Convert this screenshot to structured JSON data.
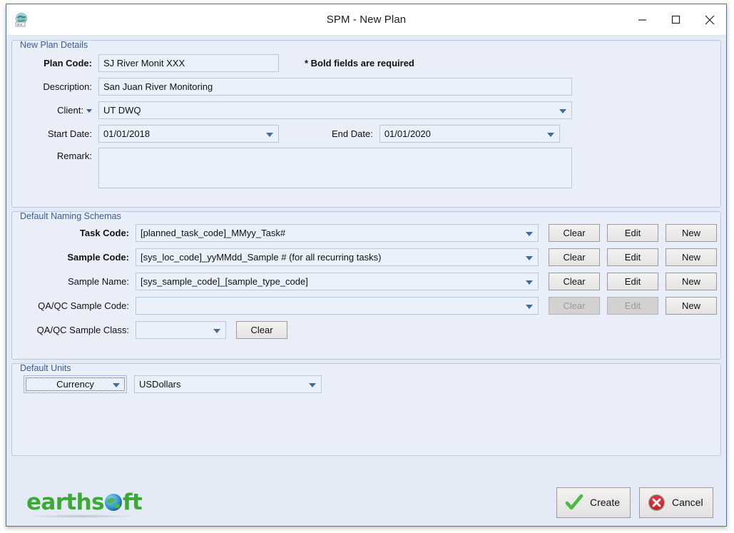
{
  "window": {
    "title": "SPM - New Plan",
    "app_icon": "globe-app-icon",
    "minimize": "–",
    "maximize": "□",
    "close": "✕"
  },
  "plan_details": {
    "legend": "New Plan Details",
    "required_note": "* Bold fields are required",
    "fields": {
      "plan_code_label": "Plan Code:",
      "plan_code_value": "SJ River Monit XXX",
      "description_label": "Description:",
      "description_value": "San Juan River Monitoring",
      "client_label": "Client:",
      "client_value": "UT DWQ",
      "start_date_label": "Start Date:",
      "start_date_value": "01/01/2018",
      "end_date_label": "End Date:",
      "end_date_value": "01/01/2020",
      "remark_label": "Remark:",
      "remark_value": ""
    }
  },
  "naming_schemas": {
    "legend": "Default Naming Schemas",
    "buttons": {
      "clear": "Clear",
      "edit": "Edit",
      "new": "New"
    },
    "rows": [
      {
        "label": "Task Code:",
        "bold": true,
        "value": "[planned_task_code]_MMyy_Task#",
        "clear_enabled": true,
        "edit_enabled": true,
        "new_enabled": true
      },
      {
        "label": "Sample Code:",
        "bold": true,
        "value": "[sys_loc_code]_yyMMdd_Sample # (for all recurring tasks)",
        "clear_enabled": true,
        "edit_enabled": true,
        "new_enabled": true
      },
      {
        "label": "Sample Name:",
        "bold": false,
        "value": "[sys_sample_code]_[sample_type_code]",
        "clear_enabled": true,
        "edit_enabled": true,
        "new_enabled": true
      },
      {
        "label": "QA/QC Sample Code:",
        "bold": false,
        "value": "",
        "clear_enabled": false,
        "edit_enabled": false,
        "new_enabled": true
      }
    ],
    "sample_class": {
      "label": "QA/QC Sample Class:",
      "value": "",
      "clear_label": "Clear"
    }
  },
  "default_units": {
    "legend": "Default Units",
    "currency_button": "Currency",
    "currency_value": "USDollars"
  },
  "footer": {
    "logo_text_left": "earths",
    "logo_text_right": "ft",
    "logo_icon": "globe-icon",
    "create_label": "Create",
    "create_icon": "green-check-icon",
    "cancel_label": "Cancel",
    "cancel_icon": "red-x-circle-icon"
  },
  "colors": {
    "window_border": "#3e7bb6",
    "panel_bg": "#e4eaf6",
    "group_bg": "#e9eef8",
    "field_bg": "#eaf1fb",
    "field_border": "#b4c9e2",
    "legend_text": "#3b5c9c",
    "logo_green": "#3aaa35",
    "cancel_red": "#cc2229",
    "check_green": "#4cb944"
  }
}
